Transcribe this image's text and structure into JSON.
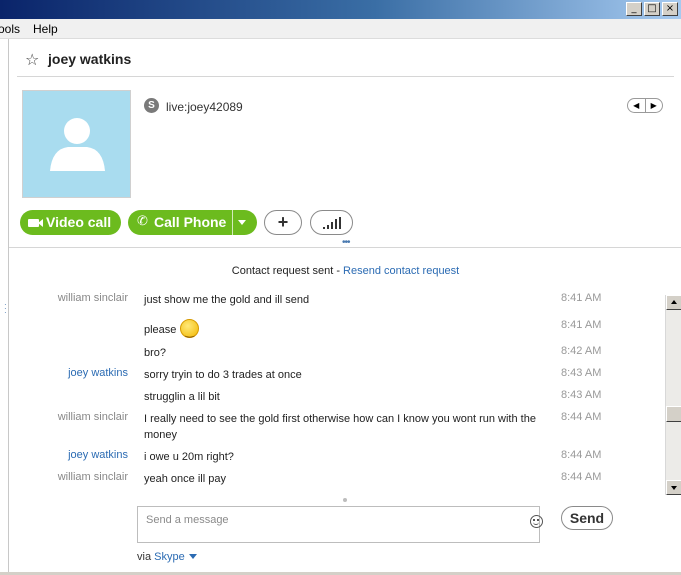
{
  "window": {
    "buttons": {
      "minimize": "_",
      "maximize": "□",
      "close": "×"
    }
  },
  "menu": [
    {
      "label": "ools"
    },
    {
      "label": "Help"
    }
  ],
  "header": {
    "contact_name": "joey watkins"
  },
  "profile": {
    "skype_id": "live:joey42089"
  },
  "actions": {
    "video_call_label": "Video call",
    "call_phone_label": "Call Phone",
    "add_label": "+"
  },
  "notice": {
    "text": "Contact request sent - ",
    "link": "Resend contact request"
  },
  "messages": [
    {
      "sender": "william sinclair",
      "text": "just show me the gold and ill send",
      "time": "8:41 AM",
      "me": false
    },
    {
      "sender": "",
      "text": "please",
      "time": "8:41 AM",
      "me": false,
      "emoticon": "smile"
    },
    {
      "sender": "",
      "text": "bro?",
      "time": "8:42 AM",
      "me": false
    },
    {
      "sender": "joey watkins",
      "text": "sorry tryin to do 3 trades at once",
      "time": "8:43 AM",
      "me": true
    },
    {
      "sender": "",
      "text": "strugglin a lil bit",
      "time": "8:43 AM",
      "me": true
    },
    {
      "sender": "william sinclair",
      "text": "I really need to see the gold first otherwise how can I know you wont run with the money",
      "time": "8:44 AM",
      "me": false
    },
    {
      "sender": "joey watkins",
      "text": "i owe u 20m right?",
      "time": "8:44 AM",
      "me": true
    },
    {
      "sender": "william sinclair",
      "text": "yeah once ill pay",
      "time": "8:44 AM",
      "me": false
    }
  ],
  "compose": {
    "placeholder": "Send a message",
    "send_label": "Send",
    "via_label": "via ",
    "via_service": "Skype"
  },
  "colors": {
    "accent_green": "#6cbb1e",
    "link_blue": "#2b6bb3",
    "avatar_bg": "#a9dcef"
  }
}
